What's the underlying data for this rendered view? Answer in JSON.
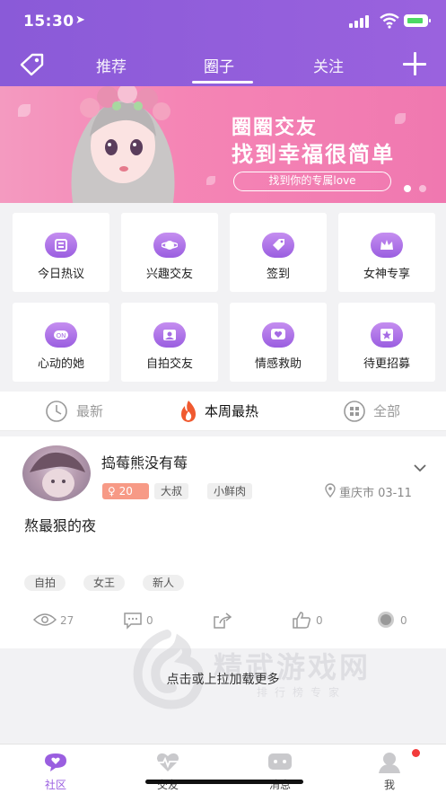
{
  "status_bar": {
    "time": "15:30"
  },
  "nav": {
    "tabs": [
      {
        "label": "推荐",
        "active": false
      },
      {
        "label": "圈子",
        "active": true
      },
      {
        "label": "关注",
        "active": false
      }
    ]
  },
  "banner": {
    "title_line1": "圈圈交友",
    "title_line2": "找到幸福很简单",
    "pill_text": "找到你的专属love"
  },
  "grid": {
    "items": [
      {
        "label": "今日热议",
        "icon": "hot-topic-icon"
      },
      {
        "label": "兴趣交友",
        "icon": "interest-planet-icon"
      },
      {
        "label": "签到",
        "icon": "checkin-tag-icon"
      },
      {
        "label": "女神专享",
        "icon": "crown-icon"
      },
      {
        "label": "心动的她",
        "icon": "on-badge-icon"
      },
      {
        "label": "自拍交友",
        "icon": "selfie-photo-icon"
      },
      {
        "label": "情感救助",
        "icon": "heart-chat-icon"
      },
      {
        "label": "待更招募",
        "icon": "recruit-star-icon"
      }
    ]
  },
  "filter": {
    "latest": "最新",
    "weekly_hot": "本周最热",
    "all": "全部",
    "active": "weekly_hot"
  },
  "post": {
    "username": "捣莓熊没有莓",
    "age": "20",
    "tags": [
      "大叔",
      "小鲜肉"
    ],
    "location": "重庆市 03-11",
    "content": "熬最狠的夜",
    "post_tags": [
      "自拍",
      "女王",
      "新人"
    ],
    "views": "27",
    "comments": "0",
    "likes": "0",
    "coins": "0"
  },
  "load_more": "点击或上拉加载更多",
  "watermark": {
    "brand": "精武游戏网",
    "tagline": "排行榜专家"
  },
  "tabbar": {
    "items": [
      {
        "label": "社区",
        "active": true
      },
      {
        "label": "交友",
        "active": false
      },
      {
        "label": "消息",
        "active": false
      },
      {
        "label": "我",
        "active": false
      }
    ]
  },
  "colors": {
    "accent": "#9a5ee0",
    "banner": "#f585b5",
    "age_badge": "#f79a86",
    "notification": "#f23b3b"
  }
}
